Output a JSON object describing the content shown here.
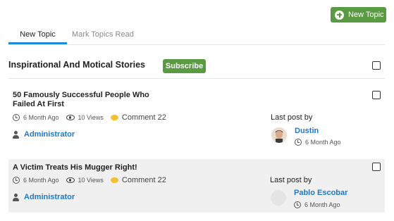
{
  "toolbar": {
    "new_topic_label": "New Topic"
  },
  "tabs": [
    {
      "label": "New Topic",
      "active": true
    },
    {
      "label": "Mark Topics Read",
      "active": false
    }
  ],
  "forum": {
    "title": "Inspirational And Motical Stories",
    "subscribe_label": "Subscribe"
  },
  "topics": [
    {
      "title": "50 Famously Successful People Who Failed At First",
      "age": "6 Month Ago",
      "views": "10 Views",
      "comment_label": "Comment",
      "comment_count": "22",
      "author": "Administrator",
      "last_post_label": "Last post by",
      "last_post_user": "Dustin",
      "last_post_age": "6 Month Ago"
    },
    {
      "title": "A Victim Treats His Mugger Right!",
      "age": "6 Month Ago",
      "views": "10 Views",
      "comment_label": "Comment",
      "comment_count": "22",
      "author": "Administrator",
      "last_post_label": "Last post by",
      "last_post_user": "Pablo Escobar",
      "last_post_age": "6 Month Ago"
    }
  ],
  "colors": {
    "accent_green": "#5a9a43",
    "link_blue": "#1e78c8",
    "tab_underline": "#1e8bd6",
    "comment_yellow": "#f2c12e"
  },
  "icons": [
    "plus-circle-icon",
    "clock-icon",
    "eye-icon",
    "comment-icon",
    "user-icon"
  ]
}
